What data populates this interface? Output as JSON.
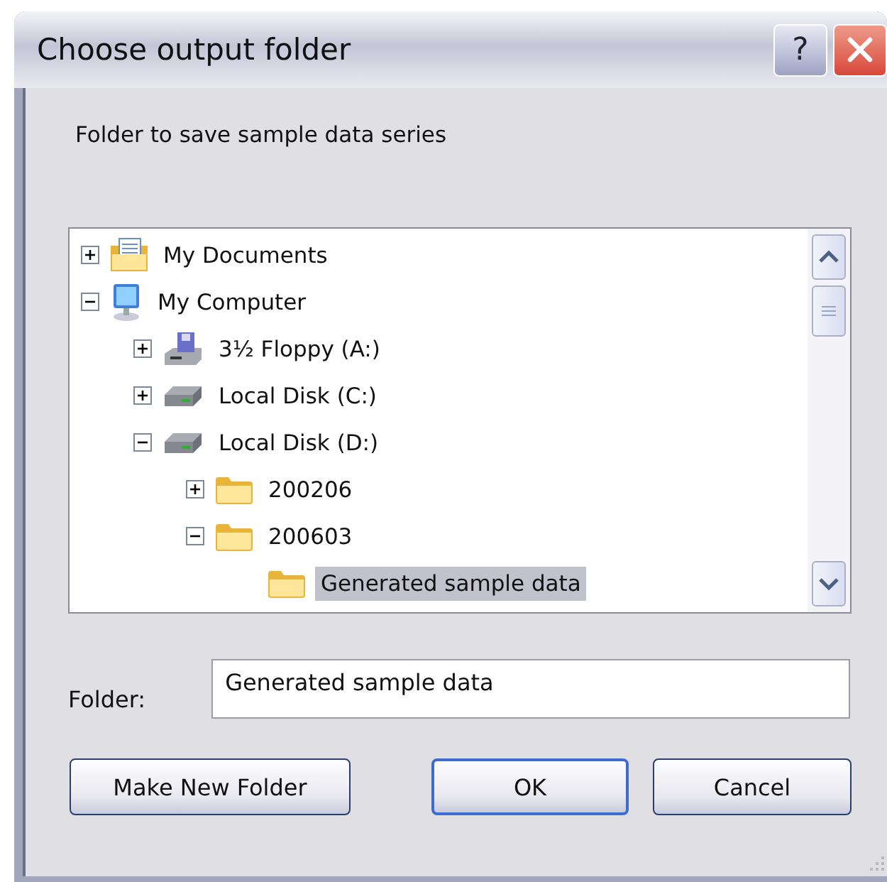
{
  "window": {
    "title": "Choose output folder",
    "controls": [
      "?"
    ]
  },
  "instruction": "Folder to save sample data series",
  "tree": [
    {
      "label": "My Documents",
      "kind": "documents",
      "expanded": false,
      "selected": false
    },
    {
      "label": "My Computer",
      "kind": "computer",
      "expanded": true,
      "selected": false,
      "children": [
        {
          "label": "3½ Floppy (A:)",
          "kind": "floppy",
          "expanded": false,
          "selected": false
        },
        {
          "label": "Local Disk (C:)",
          "kind": "disk",
          "expanded": false,
          "selected": false
        },
        {
          "label": "Local Disk (D:)",
          "kind": "disk",
          "expanded": true,
          "selected": false,
          "children": [
            {
              "label": "200206",
              "kind": "folder",
              "expanded": false,
              "selected": false
            },
            {
              "label": "200603",
              "kind": "folder",
              "expanded": true,
              "selected": false,
              "children": [
                {
                  "label": "Generated sample data",
                  "kind": "folder",
                  "selected": true
                }
              ]
            }
          ]
        }
      ]
    }
  ],
  "folder_field": {
    "label": "Folder:",
    "value": "Generated sample data"
  },
  "buttons": [
    {
      "label": "Make New Folder",
      "default": false
    },
    {
      "label": "OK",
      "default": true
    },
    {
      "label": "Cancel",
      "default": false
    }
  ]
}
